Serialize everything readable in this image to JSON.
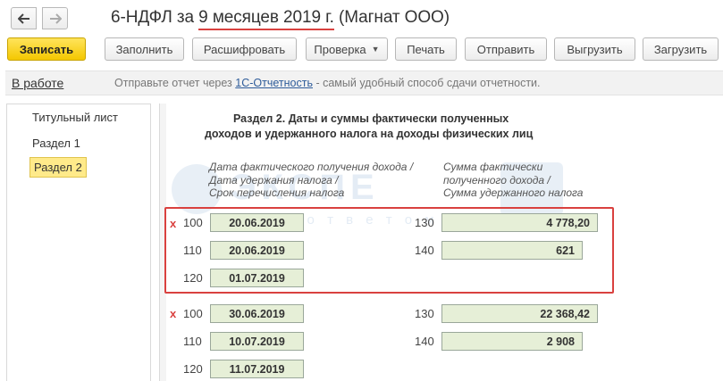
{
  "window": {
    "title": "6-НДФЛ за 9 месяцев 2019 г. (Магнат ООО)"
  },
  "toolbar": {
    "save_label": "Записать",
    "fill_label": "Заполнить",
    "decode_label": "Расшифровать",
    "check_label": "Проверка",
    "print_label": "Печать",
    "send_label": "Отправить",
    "upload_label": "Выгрузить",
    "load_label": "Загрузить"
  },
  "status": {
    "state_link": "В работе",
    "msg_before": "Отправьте отчет через ",
    "msg_link": "1С-Отчетность",
    "msg_after": " - самый удобный способ сдачи отчетности."
  },
  "sidebar": {
    "items": [
      {
        "label": "Титульный лист"
      },
      {
        "label": "Раздел 1"
      },
      {
        "label": "Раздел 2"
      }
    ]
  },
  "section": {
    "heading_line1": "Раздел 2.  Даты и суммы фактически полученных",
    "heading_line2": "доходов и удержанного налога на доходы физических лиц",
    "col_left_line1": "Дата фактического получения дохода /",
    "col_left_line2": "Дата удержания налога /",
    "col_left_line3": "Срок перечисления налога",
    "col_right_line1": "Сумма фактически",
    "col_right_line2": "полученного дохода /",
    "col_right_line3": "Сумма удержанного налога",
    "watermark_text": "ЭКСПЕ",
    "watermark_sub": "з а  о т в е т о м  к  у ч е т у  в"
  },
  "blocks": [
    {
      "mark": "x",
      "c100": "100",
      "v100": "20.06.2019",
      "c110": "110",
      "v110": "20.06.2019",
      "c120": "120",
      "v120": "01.07.2019",
      "c130": "130",
      "v130": "4 778,20",
      "c140": "140",
      "v140": "621"
    },
    {
      "mark": "x",
      "c100": "100",
      "v100": "30.06.2019",
      "c110": "110",
      "v110": "10.07.2019",
      "c120": "120",
      "v120": "11.07.2019",
      "c130": "130",
      "v130": "22 368,42",
      "c140": "140",
      "v140": "2 908"
    }
  ],
  "colors": {
    "accent_red": "#d9413f",
    "primary_button": "#f4c700",
    "field_fill": "#e6efd7",
    "active_item": "#ffea8a"
  }
}
